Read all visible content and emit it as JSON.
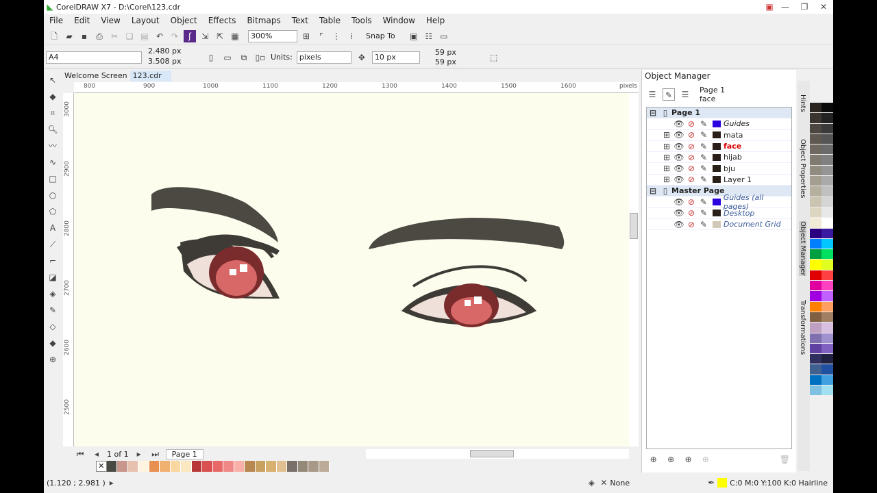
{
  "title": "CorelDRAW X7 - D:\\Corel\\123.cdr",
  "menu": [
    "File",
    "Edit",
    "View",
    "Layout",
    "Object",
    "Effects",
    "Bitmaps",
    "Text",
    "Table",
    "Tools",
    "Window",
    "Help"
  ],
  "toolbar": {
    "zoom": "300%",
    "snap_to": "Snap To"
  },
  "property_bar": {
    "page_size": "A4",
    "width": "2.480 px",
    "height": "3.508 px",
    "units_label": "Units:",
    "units": "pixels",
    "nudge": "10 px",
    "dup_x": "59 px",
    "dup_y": "59 px"
  },
  "doc_tabs": [
    "Welcome Screen",
    "123.cdr"
  ],
  "ruler": {
    "top": [
      "800",
      "900",
      "1000",
      "1100",
      "1200",
      "1300",
      "1400",
      "1500",
      "1600"
    ],
    "unit": "pixels",
    "left": [
      "3000",
      "2900",
      "2800",
      "2700",
      "2600",
      "2500"
    ]
  },
  "object_manager": {
    "title": "Object Manager",
    "page": "Page 1",
    "layer": "face",
    "rows": [
      {
        "label": "Page 1",
        "type": "header",
        "color": null
      },
      {
        "label": "Guides",
        "type": "guide",
        "color": "#2a00e0"
      },
      {
        "label": "mata",
        "type": "layer",
        "color": "#2a1e18"
      },
      {
        "label": "face",
        "type": "active",
        "color": "#2a1e18"
      },
      {
        "label": "hijab",
        "type": "layer",
        "color": "#2a1e18"
      },
      {
        "label": "bju",
        "type": "layer",
        "color": "#2a1e18"
      },
      {
        "label": "Layer 1",
        "type": "layer",
        "color": "#2a1e18"
      },
      {
        "label": "Master Page",
        "type": "header",
        "color": null
      },
      {
        "label": "Guides (all pages)",
        "type": "master",
        "color": "#2a00e0"
      },
      {
        "label": "Desktop",
        "type": "master",
        "color": "#2a1e18"
      },
      {
        "label": "Document Grid",
        "type": "master",
        "color": "#d2c8b8"
      }
    ]
  },
  "dockers": [
    "Hints",
    "Object Properties",
    "Object Manager",
    "Transformations"
  ],
  "page_nav": {
    "count": "1 of 1",
    "page_tab": "Page 1"
  },
  "status": {
    "coords": "(1.120 ; 2.981 )",
    "fill": "None",
    "outline": "C:0 M:0 Y:100 K:0  Hairline"
  },
  "colors": {
    "outline_swatch": "#ffff00"
  },
  "doc_palette": [
    "#4a4a44",
    "#c8968a",
    "#e8c0b0",
    "#fff4e0",
    "#e89050",
    "#f0b070",
    "#f8d8a0",
    "#fce8c0",
    "#b83838",
    "#d85050",
    "#e86868",
    "#f08888",
    "#f8b0a8",
    "#b88850",
    "#c8a060",
    "#d8b070",
    "#e0c090",
    "#787068",
    "#948878",
    "#a89888",
    "#bcab98"
  ],
  "palette": [
    "#2a2420",
    "#0a0a0a",
    "#3a3430",
    "#222",
    "#4c4640",
    "#3a3a3a",
    "#5e5850",
    "#555",
    "#6e6860",
    "#6a6a6a",
    "#807a70",
    "#808080",
    "#928c80",
    "#959595",
    "#a49e90",
    "#aaa",
    "#b6b0a0",
    "#c0c0c0",
    "#cac4b0",
    "#d5d5d5",
    "#dcd6c0",
    "#e8e8e8",
    "#f0ead6",
    "#fff",
    "#2a0080",
    "#3a1aa0",
    "#0080ff",
    "#00c8ff",
    "#00a040",
    "#00e060",
    "#ffff00",
    "#e0ff20",
    "#e00000",
    "#ff4040",
    "#e000a0",
    "#ff40c0",
    "#a000e0",
    "#c060ff",
    "#ff8000",
    "#ffa060",
    "#806040",
    "#a08060",
    "#c0a0c0",
    "#d8c0e0",
    "#8070b0",
    "#a090d0",
    "#6040a0",
    "#8060c0",
    "#303060",
    "#202040",
    "#406090",
    "#2050a0",
    "#0070c0",
    "#40a0e0",
    "#80c0e0",
    "#a0e0f0"
  ]
}
